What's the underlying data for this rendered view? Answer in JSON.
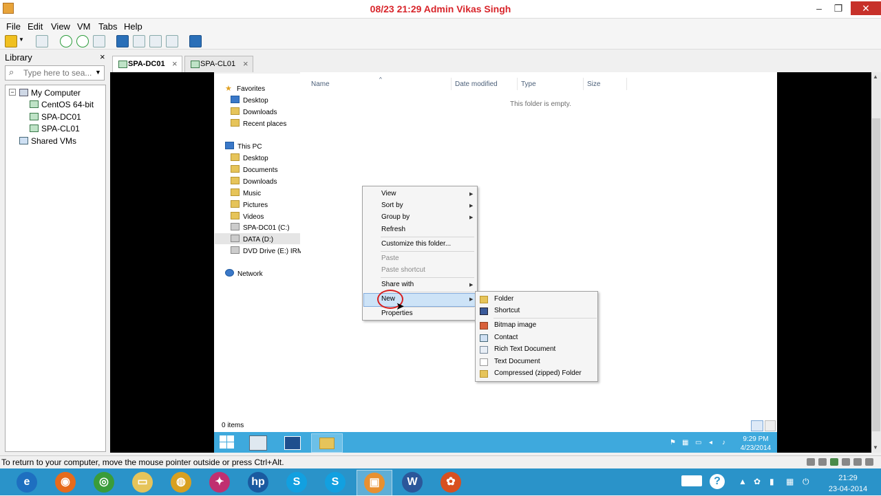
{
  "window": {
    "title": "08/23 21:29 Admin Vikas Singh",
    "controls": {
      "minimize": "–",
      "maximize": "❐",
      "close": "✕"
    }
  },
  "menubar": {
    "items": [
      "File",
      "Edit",
      "View",
      "VM",
      "Tabs",
      "Help"
    ]
  },
  "library": {
    "title": "Library",
    "close": "×",
    "search_placeholder": "Type here to sea...",
    "tree": {
      "root": "My Computer",
      "vms": [
        "CentOS 64-bit",
        "SPA-DC01",
        "SPA-CL01"
      ],
      "shared": "Shared VMs"
    }
  },
  "tabs": [
    {
      "label": "SPA-DC01",
      "close": "×",
      "active": true
    },
    {
      "label": "SPA-CL01",
      "close": "×",
      "active": false
    }
  ],
  "explorer": {
    "nav": {
      "favorites": "Favorites",
      "favorites_items": [
        "Desktop",
        "Downloads",
        "Recent places"
      ],
      "this_pc": "This PC",
      "pc_items": [
        "Desktop",
        "Documents",
        "Downloads",
        "Music",
        "Pictures",
        "Videos",
        "SPA-DC01 (C:)",
        "DATA (D:)",
        "DVD Drive (E:) IRM_S"
      ],
      "network": "Network"
    },
    "columns": [
      "Name",
      "Date modified",
      "Type",
      "Size"
    ],
    "sort_indicator": "^",
    "empty_message": "This folder is empty.",
    "status": "0 items"
  },
  "context_menu": {
    "items": [
      {
        "label": "View",
        "submenu": true,
        "disabled": false
      },
      {
        "label": "Sort by",
        "submenu": true,
        "disabled": false
      },
      {
        "label": "Group by",
        "submenu": true,
        "disabled": false
      },
      {
        "label": "Refresh",
        "submenu": false,
        "disabled": false
      },
      {
        "label": "Customize this folder...",
        "submenu": false,
        "disabled": false
      },
      {
        "label": "Paste",
        "submenu": false,
        "disabled": true
      },
      {
        "label": "Paste shortcut",
        "submenu": false,
        "disabled": true
      },
      {
        "label": "Share with",
        "submenu": true,
        "disabled": false
      },
      {
        "label": "New",
        "submenu": true,
        "disabled": false,
        "highlighted": true
      },
      {
        "label": "Properties",
        "submenu": false,
        "disabled": false
      }
    ],
    "arrow": "▶"
  },
  "new_submenu": {
    "items": [
      "Folder",
      "Shortcut",
      "Bitmap image",
      "Contact",
      "Rich Text Document",
      "Text Document",
      "Compressed (zipped) Folder"
    ]
  },
  "guest_taskbar": {
    "time": "9:29 PM",
    "date": "4/23/2014",
    "tray_icons": [
      "flag-icon",
      "network-icon",
      "display-icon",
      "speaker-icon"
    ]
  },
  "vmware_status": {
    "text": "To return to your computer, move the mouse pointer outside or press Ctrl+Alt."
  },
  "host_taskbar": {
    "time": "21:29",
    "date": "23-04-2014",
    "apps": [
      "ie-icon",
      "firefox-icon",
      "chrome-icon",
      "file-explorer-icon",
      "media-player-icon",
      "paint-icon",
      "hp-icon",
      "skype-icon",
      "skype-icon",
      "vmware-icon",
      "word-icon",
      "game-icon"
    ],
    "app_glyphs": [
      "e",
      "◉",
      "◎",
      "▭",
      "◍",
      "✦",
      "hp",
      "S",
      "S",
      "▣",
      "W",
      "✿"
    ],
    "app_colors": [
      "#1e6fc0",
      "#e66b1c",
      "#3a9c3a",
      "#e6c45a",
      "#d8a020",
      "#c03070",
      "#1a5aa0",
      "#12a0e0",
      "#12a0e0",
      "#e89030",
      "#2b579a",
      "#d85020"
    ]
  },
  "colors": {
    "title_text": "#d8242a",
    "guest_taskbar": "#3ea9dd",
    "host_taskbar": "#2a93c9",
    "highlight": "#cde3f7"
  }
}
